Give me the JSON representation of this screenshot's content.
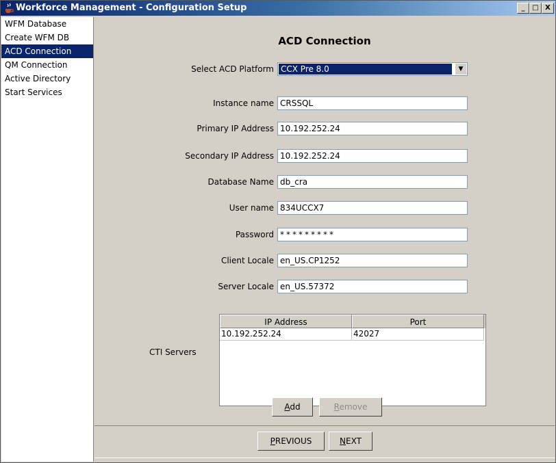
{
  "window": {
    "title": "Workforce Management - Configuration Setup",
    "controls": {
      "minimize": "_",
      "maximize": "□",
      "close": "X"
    }
  },
  "nav": {
    "items": [
      {
        "label": "WFM Database",
        "active": false
      },
      {
        "label": "Create WFM DB",
        "active": false
      },
      {
        "label": "ACD Connection",
        "active": true
      },
      {
        "label": "QM Connection",
        "active": false
      },
      {
        "label": "Active Directory",
        "active": false
      },
      {
        "label": "Start Services",
        "active": false
      }
    ]
  },
  "page": {
    "heading": "ACD Connection"
  },
  "form": {
    "platform": {
      "label": "Select ACD Platform",
      "value": "CCX Pre 8.0"
    },
    "instance_name": {
      "label": "Instance name",
      "value": "CRSSQL"
    },
    "primary_ip": {
      "label": "Primary IP Address",
      "value": "10.192.252.24"
    },
    "secondary_ip": {
      "label": "Secondary IP Address",
      "value": "10.192.252.24"
    },
    "database_name": {
      "label": "Database Name",
      "value": "db_cra"
    },
    "user_name": {
      "label": "User name",
      "value": "834UCCX7"
    },
    "password": {
      "label": "Password",
      "value": "*********"
    },
    "client_locale": {
      "label": "Client Locale",
      "value": "en_US.CP1252"
    },
    "server_locale": {
      "label": "Server Locale",
      "value": "en_US.57372"
    }
  },
  "cti": {
    "label": "CTI Servers",
    "columns": [
      "IP Address",
      "Port"
    ],
    "rows": [
      [
        "10.192.252.24",
        "42027"
      ]
    ]
  },
  "buttons": {
    "add": {
      "mnemonic": "A",
      "rest": "dd"
    },
    "remove": {
      "mnemonic": "R",
      "rest": "emove"
    },
    "previous": {
      "mnemonic": "P",
      "rest": "REVIOUS"
    },
    "next": {
      "mnemonic": "N",
      "rest": "EXT"
    }
  },
  "colors": {
    "selection": "#0a246a",
    "titlebar_start": "#0a246a",
    "panel": "#d4d0c8"
  }
}
